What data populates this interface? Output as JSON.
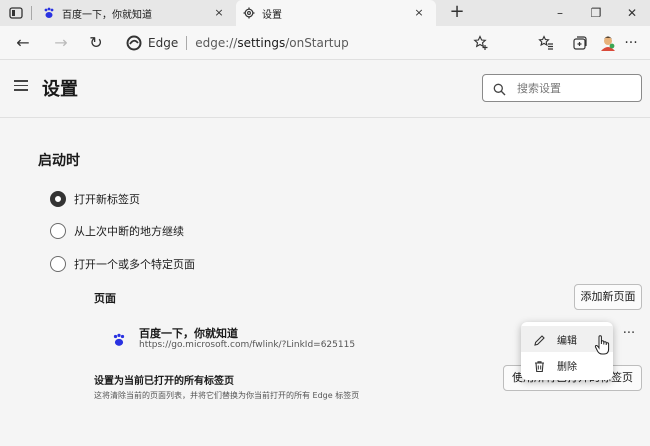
{
  "tabs": [
    {
      "title": "百度一下，你就知道",
      "icon": "baidu-paw-icon",
      "close": "×"
    },
    {
      "title": "设置",
      "icon": "gear-icon",
      "close": "×"
    }
  ],
  "tabbar": {
    "new_tab": "+",
    "minimize": "–",
    "maximize": "❐",
    "close": "✕"
  },
  "navbar": {
    "back": "←",
    "forward": "→",
    "refresh": "↻",
    "site_label": "Edge",
    "url_scheme": "edge://",
    "url_host": "settings",
    "url_path": "/onStartup",
    "more": "···"
  },
  "header": {
    "title": "设置",
    "search_placeholder": "搜索设置"
  },
  "startup": {
    "section_title": "启动时",
    "options": [
      {
        "label": "打开新标签页",
        "checked": true
      },
      {
        "label": "从上次中断的地方继续",
        "checked": false
      },
      {
        "label": "打开一个或多个特定页面",
        "checked": false
      }
    ],
    "pages_label": "页面",
    "add_page_button": "添加新页面",
    "page_items": [
      {
        "title": "百度一下，你就知道",
        "url": "https://go.microsoft.com/fwlink/?LinkId=625115"
      }
    ],
    "use_current_title": "设置为当前已打开的所有标签页",
    "use_current_desc": "这将清除当前的页面列表，并将它们替换为你当前打开的所有 Edge 标签页",
    "use_current_button": "使用所有已打开的标签页"
  },
  "context_menu": {
    "items": [
      {
        "label": "编辑",
        "icon": "pencil-icon"
      },
      {
        "label": "删除",
        "icon": "trash-icon"
      }
    ]
  },
  "colors": {
    "tabbar_bg": "#e7e7e7",
    "page_bg": "#f5f5f5",
    "baidu_blue": "#2932e1"
  }
}
